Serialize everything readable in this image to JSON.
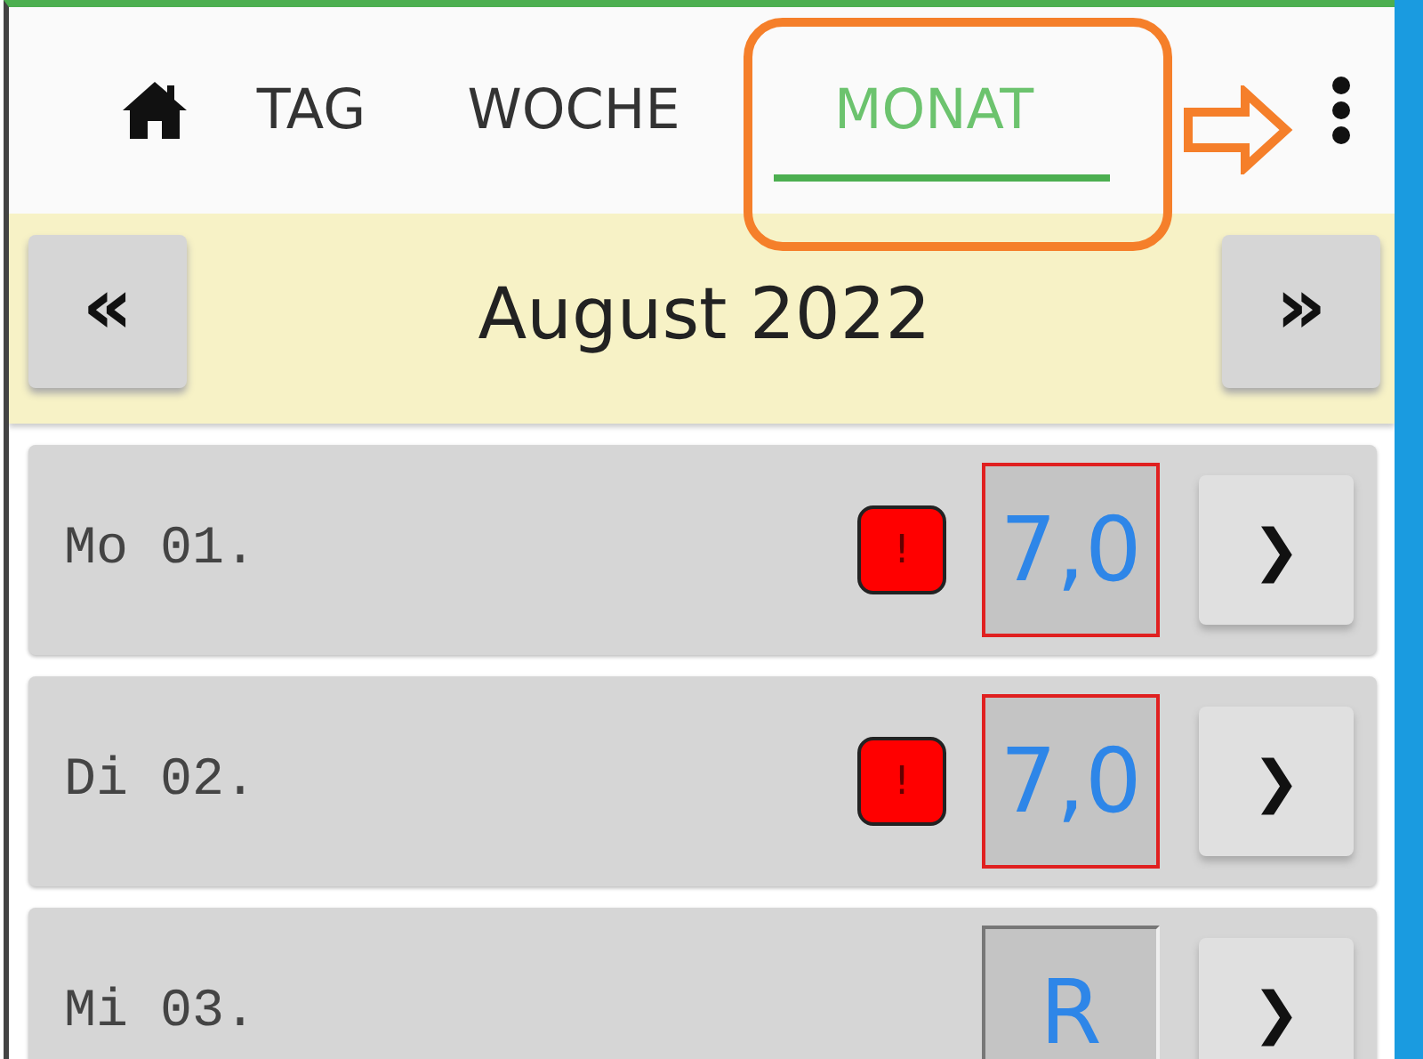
{
  "tabs": [
    {
      "kind": "home",
      "selected": false
    },
    {
      "kind": "text",
      "label": "TAG",
      "selected": false
    },
    {
      "kind": "text",
      "label": "WOCHE",
      "selected": false
    },
    {
      "kind": "text",
      "label": "MONAT",
      "selected": true
    }
  ],
  "annotations": {
    "tab_frame": true,
    "pointer_arrow": true
  },
  "month": {
    "prev": "«",
    "title": "August 2022",
    "next": "»"
  },
  "days": [
    {
      "date": "Mo 01.",
      "alert": "!",
      "value": "7,0",
      "over_limit": true,
      "open": "❯"
    },
    {
      "date": "Di 02.",
      "alert": "!",
      "value": "7,0",
      "over_limit": true,
      "open": "❯"
    },
    {
      "date": "Mi 03.",
      "value": "R",
      "over_limit": false,
      "open": "❯"
    }
  ]
}
